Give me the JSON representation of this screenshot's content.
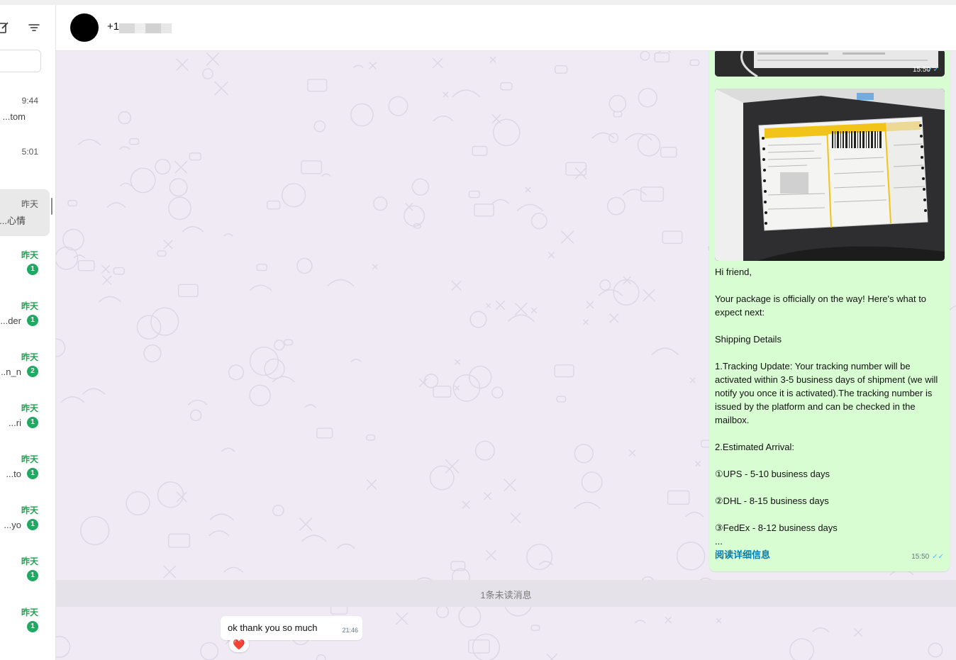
{
  "header": {
    "contact_name": "+1"
  },
  "sidebar": {
    "items": [
      {
        "time": "9:44",
        "preview": "tom...",
        "unread": false,
        "badge": ""
      },
      {
        "time": "5:01",
        "preview": "",
        "unread": false,
        "badge": ""
      },
      {
        "time": "昨天",
        "preview": "心情...",
        "unread": false,
        "badge": "",
        "selected": true
      },
      {
        "time": "昨天",
        "preview": "",
        "unread": true,
        "badge": "1"
      },
      {
        "time": "昨天",
        "preview": "der...",
        "unread": true,
        "badge": "1"
      },
      {
        "time": "昨天",
        "preview": "n_n...",
        "unread": true,
        "badge": "2"
      },
      {
        "time": "昨天",
        "preview": "ri...",
        "unread": true,
        "badge": "1"
      },
      {
        "time": "昨天",
        "preview": "to...",
        "unread": true,
        "badge": "1"
      },
      {
        "time": "昨天",
        "preview": "yo...",
        "unread": true,
        "badge": "1"
      },
      {
        "time": "昨天",
        "preview": "",
        "unread": true,
        "badge": "1"
      },
      {
        "time": "昨天",
        "preview": "",
        "unread": true,
        "badge": "1"
      }
    ]
  },
  "messages": {
    "image1_time": "15:50",
    "outgoing": {
      "lines": [
        "Hi friend,",
        "",
        "Your package is officially on the way!  Here's what to expect next:",
        "",
        "Shipping Details",
        "",
        "1.Tracking Update: Your tracking number will be activated within 3-5 business days of shipment (we will notify you once it is activated).The tracking number is issued by the platform and can be checked in the mailbox.",
        "",
        "2.Estimated Arrival:",
        "",
        "①UPS - 5-10 business days",
        "",
        "②DHL - 8-15 business days",
        "",
        "③FedEx - 8-12 business days",
        "..."
      ],
      "read_more": "阅读详细信息",
      "time": "15:50"
    },
    "unread_divider": "1条未读消息",
    "incoming": {
      "text": "ok thank you so much",
      "time": "21:46",
      "reaction": "❤️"
    }
  }
}
